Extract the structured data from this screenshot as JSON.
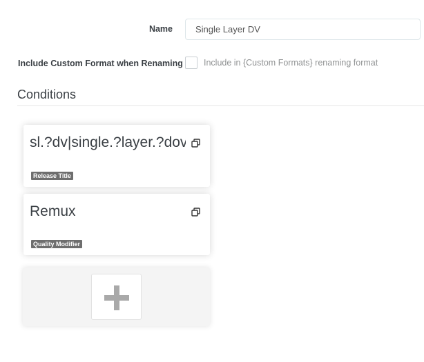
{
  "form": {
    "name_label": "Name",
    "name_value": "Single Layer DV",
    "include_label": "Include Custom Format when Renaming",
    "include_checked": false,
    "include_help": "Include in {Custom Formats} renaming format"
  },
  "conditions": {
    "title": "Conditions",
    "items": [
      {
        "name": "sl.?dv|single.?layer.?dovi",
        "type": "Release Title",
        "icon": "clone-icon"
      },
      {
        "name": "Remux",
        "type": "Quality Modifier",
        "icon": "clone-icon"
      }
    ],
    "add_icon": "plus-icon"
  },
  "colors": {
    "tag_background": "#6e6e6e",
    "plus_icon": "#a9a9a9"
  }
}
